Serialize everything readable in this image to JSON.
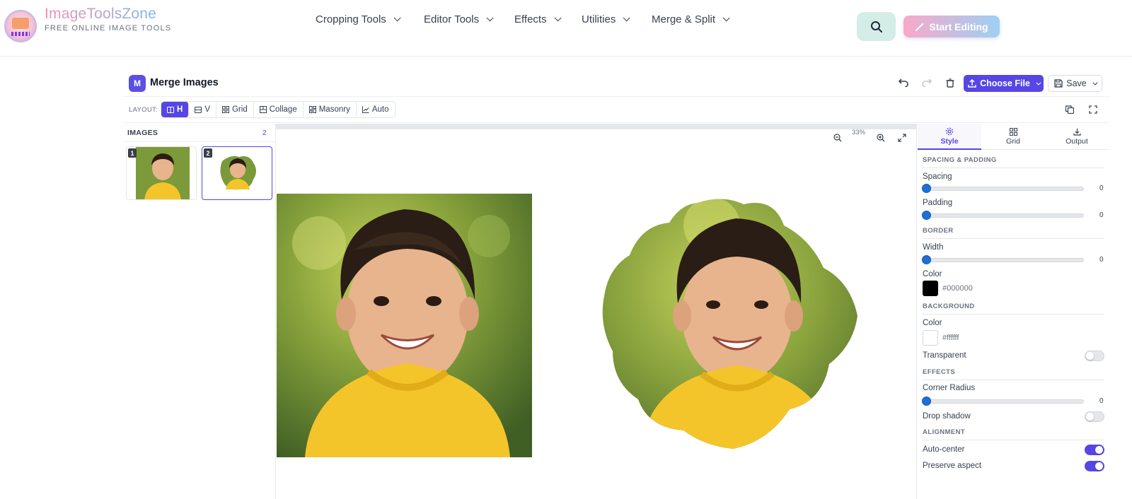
{
  "brand": {
    "name": "ImageToolsZone",
    "tagline": "FREE ONLINE IMAGE TOOLS"
  },
  "nav": {
    "items": [
      {
        "label": "Cropping Tools"
      },
      {
        "label": "Editor Tools"
      },
      {
        "label": "Effects"
      },
      {
        "label": "Utilities"
      },
      {
        "label": "Merge & Split"
      }
    ],
    "search_icon": "search-icon",
    "start_label": "Start Editing"
  },
  "editor": {
    "badge": "M",
    "title": "Merge Images",
    "choose_label": "Choose File",
    "save_label": "Save"
  },
  "layout": {
    "label": "LAYOUT:",
    "options": [
      {
        "label": "H",
        "active": true
      },
      {
        "label": "V",
        "active": false
      },
      {
        "label": "Grid",
        "active": false
      },
      {
        "label": "Collage",
        "active": false
      },
      {
        "label": "Masonry",
        "active": false
      },
      {
        "label": "Auto",
        "active": false
      }
    ]
  },
  "images_panel": {
    "title": "IMAGES",
    "count": "2",
    "thumbs": [
      {
        "num": "1"
      },
      {
        "num": "2"
      }
    ]
  },
  "canvas": {
    "zoom": "33%"
  },
  "settings": {
    "tabs": [
      {
        "label": "Style",
        "icon": "gear-icon",
        "active": true
      },
      {
        "label": "Grid",
        "icon": "grid-icon",
        "active": false
      },
      {
        "label": "Output",
        "icon": "download-icon",
        "active": false
      }
    ],
    "sections": {
      "spacing_padding": "SPACING & PADDING",
      "border": "BORDER",
      "background": "BACKGROUND",
      "effects": "EFFECTS",
      "alignment": "ALIGNMENT"
    },
    "spacing": {
      "label": "Spacing",
      "value": "0"
    },
    "padding": {
      "label": "Padding",
      "value": "0"
    },
    "border_width": {
      "label": "Width",
      "value": "0"
    },
    "border_color": {
      "label": "Color",
      "hex": "#000000"
    },
    "bg_color": {
      "label": "Color",
      "hex": "#ffffff"
    },
    "transparent": {
      "label": "Transparent",
      "on": false
    },
    "corner_radius": {
      "label": "Corner Radius",
      "value": "0"
    },
    "drop_shadow": {
      "label": "Drop shadow",
      "on": false
    },
    "auto_center": {
      "label": "Auto-center",
      "on": true
    },
    "preserve_aspect": {
      "label": "Preserve aspect",
      "on": true
    }
  },
  "colors": {
    "accent": "#5646e5",
    "slider_thumb": "#1d6fd8",
    "shirt": "#f4c52a"
  }
}
